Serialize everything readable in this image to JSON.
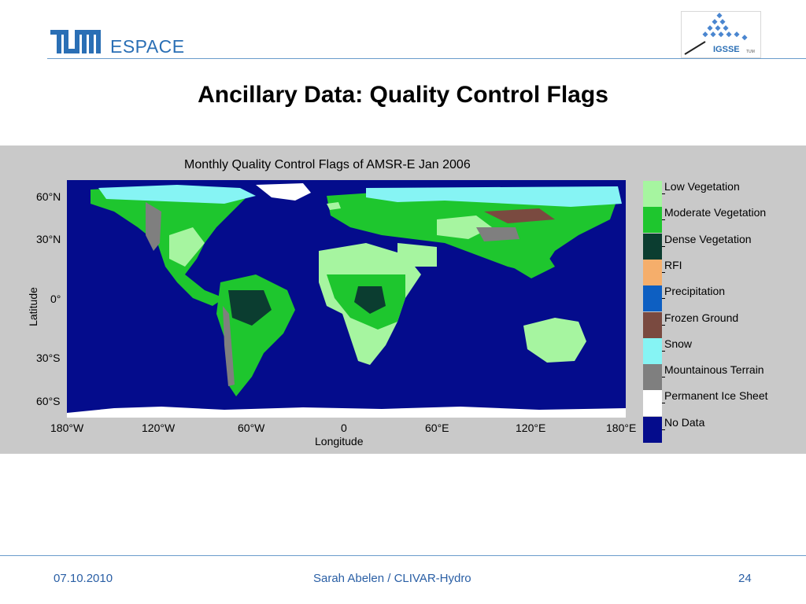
{
  "header": {
    "logo_text": "ESPACE",
    "partner_logo_text": "IGSSE",
    "partner_logo_sub": "TUM"
  },
  "slide": {
    "title": "Ancillary Data: Quality Control Flags"
  },
  "figure": {
    "title": "Monthly Quality Control Flags of AMSR-E Jan 2006",
    "xlabel": "Longitude",
    "ylabel": "Latitude",
    "x_ticks": [
      "180°W",
      "120°W",
      "60°W",
      "0",
      "60°E",
      "120°E",
      "180°E"
    ],
    "y_ticks": [
      "60°N",
      "30°N",
      "0°",
      "30°S",
      "60°S"
    ],
    "legend": [
      {
        "label": "Low Vegetation",
        "color": "#a6f5a0"
      },
      {
        "label": "Moderate Vegetation",
        "color": "#1ec62e"
      },
      {
        "label": "Dense Vegetation",
        "color": "#0b3d30"
      },
      {
        "label": "RFI",
        "color": "#f5ae6b"
      },
      {
        "label": "Precipitation",
        "color": "#0d5fc2"
      },
      {
        "label": "Frozen Ground",
        "color": "#7a4a40"
      },
      {
        "label": "Snow",
        "color": "#86f4f4"
      },
      {
        "label": "Mountainous Terrain",
        "color": "#7f7f7f"
      },
      {
        "label": "Permanent Ice Sheet",
        "color": "#ffffff"
      },
      {
        "label": "No Data",
        "color": "#040c8c"
      }
    ]
  },
  "footer": {
    "date": "07.10.2010",
    "author": "Sarah Abelen / CLIVAR-Hydro",
    "page": "24"
  }
}
